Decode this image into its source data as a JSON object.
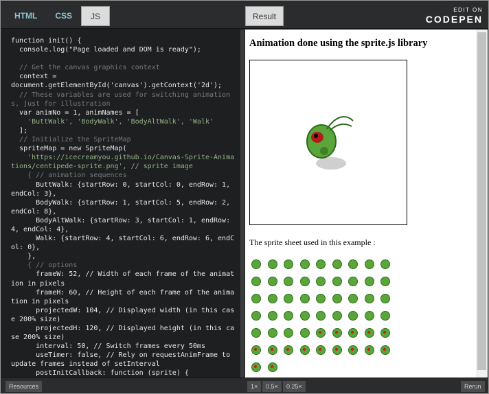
{
  "editor_tabs": {
    "html": "HTML",
    "css": "CSS",
    "js": "JS"
  },
  "result_tab": "Result",
  "logo": {
    "edit_on": "EDIT ON",
    "brand": "CODEPEN"
  },
  "code_lines": [
    "function init() {",
    "  console.log(\"Page loaded and DOM is ready\");",
    "",
    "  // Get the canvas graphics context",
    "  context =",
    "document.getElementById('canvas').getContext('2d');",
    "  // These variables are used for switching animations, just for illustration",
    "  var animNo = 1, animNames = [",
    "    'ButtWalk', 'BodyWalk', 'BodyAltWalk', 'Walk'",
    "  ];",
    "  // Initialize the SpriteMap",
    "  spriteMap = new SpriteMap(",
    "    'https://icecreamyou.github.io/Canvas-Sprite-Animations/centipede-sprite.png', // sprite image",
    "    { // animation sequences",
    "      ButtWalk: {startRow: 0, startCol: 0, endRow: 1, endCol: 3},",
    "      BodyWalk: {startRow: 1, startCol: 5, endRow: 2, endCol: 8},",
    "      BodyAltWalk: {startRow: 3, startCol: 1, endRow: 4, endCol: 4},",
    "      Walk: {startRow: 4, startCol: 6, endRow: 6, endCol: 0},",
    "    },",
    "    { // options",
    "      frameW: 52, // Width of each frame of the animation in pixels",
    "      frameH: 60, // Height of each frame of the animation in pixels",
    "      projectedW: 104, // Displayed width (in this case 200% size)",
    "      projectedH: 120, // Displayed height (in this case 200% size)",
    "      interval: 50, // Switch frames every 50ms",
    "      useTimer: false, // Rely on requestAnimFrame to update frames instead of setInterval",
    "      postInitCallback: function (sprite) {"
  ],
  "result": {
    "heading": "Animation done using the sprite.js library",
    "sheet_caption": "The sprite sheet used in this example :"
  },
  "bottom": {
    "resources": "Resources",
    "zoom_1x": "1×",
    "zoom_05x": "0.5×",
    "zoom_025x": "0.25×",
    "rerun": "Rerun"
  }
}
